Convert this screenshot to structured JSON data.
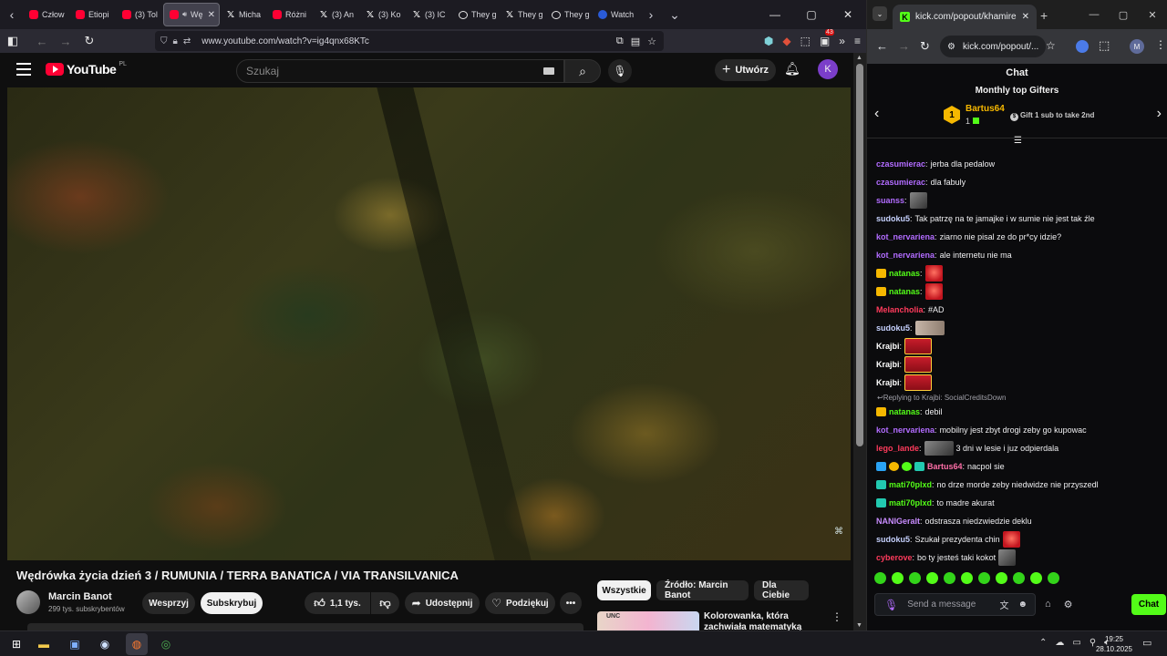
{
  "firefox": {
    "tabs": [
      {
        "icon": "youtube",
        "label": "Człow"
      },
      {
        "icon": "youtube",
        "label": "Etiopi"
      },
      {
        "icon": "youtube",
        "label": "(3) Tol"
      },
      {
        "icon": "youtube",
        "label": "Wę",
        "active": true
      },
      {
        "icon": "x",
        "label": "Micha"
      },
      {
        "icon": "youtube",
        "label": "Różni"
      },
      {
        "icon": "x",
        "label": "(3) An"
      },
      {
        "icon": "x",
        "label": "(3) Ko"
      },
      {
        "icon": "x",
        "label": "(3) IC"
      },
      {
        "icon": "web",
        "label": "They g"
      },
      {
        "icon": "x",
        "label": "They g"
      },
      {
        "icon": "web",
        "label": "They g"
      },
      {
        "icon": "web",
        "label": "Watch"
      }
    ],
    "url": "www.youtube.com/watch?v=ig4qnx68KTc",
    "ext_badge": "43"
  },
  "youtube": {
    "logo": "YouTube",
    "region": "PL",
    "search_placeholder": "Szukaj",
    "create_label": "Utwórz",
    "avatar_letter": "K",
    "video_title": "Wędrówka życia dzień 3 / RUMUNIA / TERRA BANATICA / VIA TRANSILVANICA",
    "channel": {
      "name": "Marcin Banot",
      "subs": "299 tys. subskrybentów"
    },
    "buttons": {
      "support": "Wesprzyj",
      "subscribe": "Subskrybuj",
      "likes": "1,1 tys.",
      "share": "Udostępnij",
      "thanks": "Podziękuj"
    },
    "chips": [
      "Wszystkie",
      "Źródło: Marcin Banot",
      "Dla Ciebie"
    ],
    "recommendation": {
      "thumb_text": "UNC",
      "title": "Kolorowanka, która zachwiała matematyką"
    }
  },
  "chrome": {
    "tab_title": "kick.com/popout/khamires/chat",
    "omnibox": "kick.com/popout/...",
    "profile_letter": "M"
  },
  "kick": {
    "chat_title": "Chat",
    "gifters_title": "Monthly top Gifters",
    "top_gifter": {
      "rank": "1",
      "name": "Bartus64",
      "count": "1"
    },
    "gift_cta": "Gift 1 sub to take 2nd",
    "messages": [
      {
        "user": "czasumierac",
        "color": "#b26cff",
        "text": "jerba dla pedalow"
      },
      {
        "user": "czasumierac",
        "color": "#b26cff",
        "text": "dla fabuly"
      },
      {
        "user": "suanss",
        "color": "#b26cff",
        "text": "",
        "emote": "gray"
      },
      {
        "user": "sudoku5",
        "color": "#c7d2ff",
        "text": "Tak patrzę na te jamajke i w sumie nie jest tak źle"
      },
      {
        "user": "kot_nervariena",
        "color": "#b26cff",
        "text": "ziarno nie pisal ze do pr*cy idzie?"
      },
      {
        "user": "kot_nervariena",
        "color": "#b26cff",
        "text": "ale internetu nie ma"
      },
      {
        "user": "natanas",
        "color": "#53fc18",
        "text": "",
        "badge": "crown",
        "emote": "red"
      },
      {
        "user": "natanas",
        "color": "#53fc18",
        "text": "",
        "badge": "crown",
        "emote": "red"
      },
      {
        "user": "Melancholia",
        "color": "#ff3b5c",
        "text": "#AD"
      },
      {
        "user": "sudoku5",
        "color": "#c7d2ff",
        "text": "",
        "emote": "face"
      },
      {
        "user": "Krajbi",
        "color": "#ffffff",
        "text": "",
        "emote": "card"
      },
      {
        "user": "Krajbi",
        "color": "#ffffff",
        "text": "",
        "emote": "card"
      },
      {
        "user": "Krajbi",
        "color": "#ffffff",
        "text": "",
        "emote": "card"
      },
      {
        "reply": "Replying to Krajbi: SocialCreditsDown"
      },
      {
        "user": "natanas",
        "color": "#53fc18",
        "text": "debil",
        "badge": "crown"
      },
      {
        "user": "kot_nervariena",
        "color": "#b26cff",
        "text": "mobilny jest zbyt drogi zeby go kupowac"
      },
      {
        "user": "lego_lande",
        "color": "#ff3b5c",
        "text": "3 dni w lesie i juz odpierdala",
        "emote": "gray"
      },
      {
        "user": "Bartus64",
        "color": "#ff6fa8",
        "text": "nacpol sie",
        "badge": "multi"
      },
      {
        "user": "mati70plxd",
        "color": "#53fc18",
        "text": "no drze morde zeby niedwidze nie przyszedl",
        "badge": "box"
      },
      {
        "user": "mati70plxd",
        "color": "#53fc18",
        "text": "to madre akurat",
        "badge": "box"
      },
      {
        "user": "NANIGeralt",
        "color": "#c98cff",
        "text": "odstrasza niedzwiedzie deklu"
      },
      {
        "user": "sudoku5",
        "color": "#c7d2ff",
        "text": "Szukał prezydenta chin",
        "emote": "red"
      },
      {
        "user": "cyberove",
        "color": "#ff3b5c",
        "text": "bo ty jesteś taki kokot",
        "emote": "gray"
      }
    ],
    "input_placeholder": "Send a message",
    "send_label": "Chat"
  },
  "taskbar": {
    "time": "19:25",
    "date": "28.10.2025"
  }
}
